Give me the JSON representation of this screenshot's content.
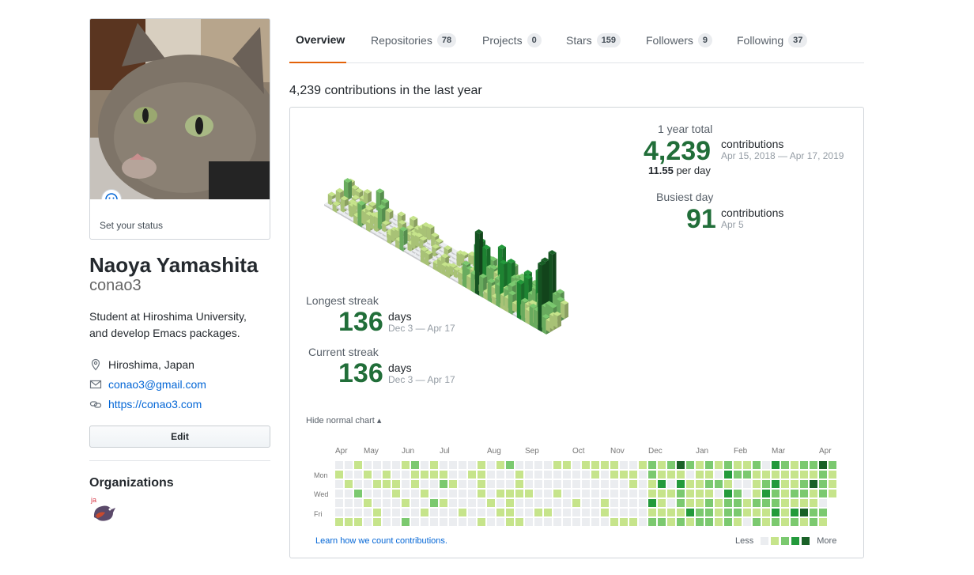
{
  "profile": {
    "status_text": "Set your status",
    "fullname": "Naoya Yamashita",
    "username": "conao3",
    "bio_line1": "Student at Hiroshima University,",
    "bio_line2": "and develop Emacs packages.",
    "location": "Hiroshima, Japan",
    "email": "conao3@gmail.com",
    "website": "https://conao3.com",
    "edit_label": "Edit",
    "organizations_title": "Organizations",
    "org_badge": "ja"
  },
  "tabs": [
    {
      "label": "Overview",
      "count": ""
    },
    {
      "label": "Repositories",
      "count": "78"
    },
    {
      "label": "Projects",
      "count": "0"
    },
    {
      "label": "Stars",
      "count": "159"
    },
    {
      "label": "Followers",
      "count": "9"
    },
    {
      "label": "Following",
      "count": "37"
    }
  ],
  "contrib": {
    "title": "4,239 contributions in the last year",
    "year_total_label": "1 year total",
    "year_total": "4,239",
    "year_unit": "contributions",
    "year_range": "Apr 15, 2018 — Apr 17, 2019",
    "per_day_value": "11.55",
    "per_day_unit": "per day",
    "busiest_label": "Busiest day",
    "busiest_value": "91",
    "busiest_unit": "contributions",
    "busiest_date": "Apr 5",
    "longest_label": "Longest streak",
    "longest_value": "136",
    "longest_unit": "days",
    "longest_range": "Dec 3 — Apr 17",
    "current_label": "Current streak",
    "current_value": "136",
    "current_unit": "days",
    "current_range": "Dec 3 — Apr 17",
    "hide_chart": "Hide normal chart ▴",
    "learn_link": "Learn how we count contributions.",
    "legend_less": "Less",
    "legend_more": "More",
    "months": [
      "Apr",
      "May",
      "Jun",
      "Jul",
      "Aug",
      "Sep",
      "Oct",
      "Nov",
      "Dec",
      "Jan",
      "Feb",
      "Mar",
      "Apr"
    ],
    "days": [
      "Mon",
      "Wed",
      "Fri"
    ],
    "colors": [
      "#ebedf0",
      "#c6e48b",
      "#7bc96f",
      "#239a3b",
      "#196127"
    ]
  }
}
